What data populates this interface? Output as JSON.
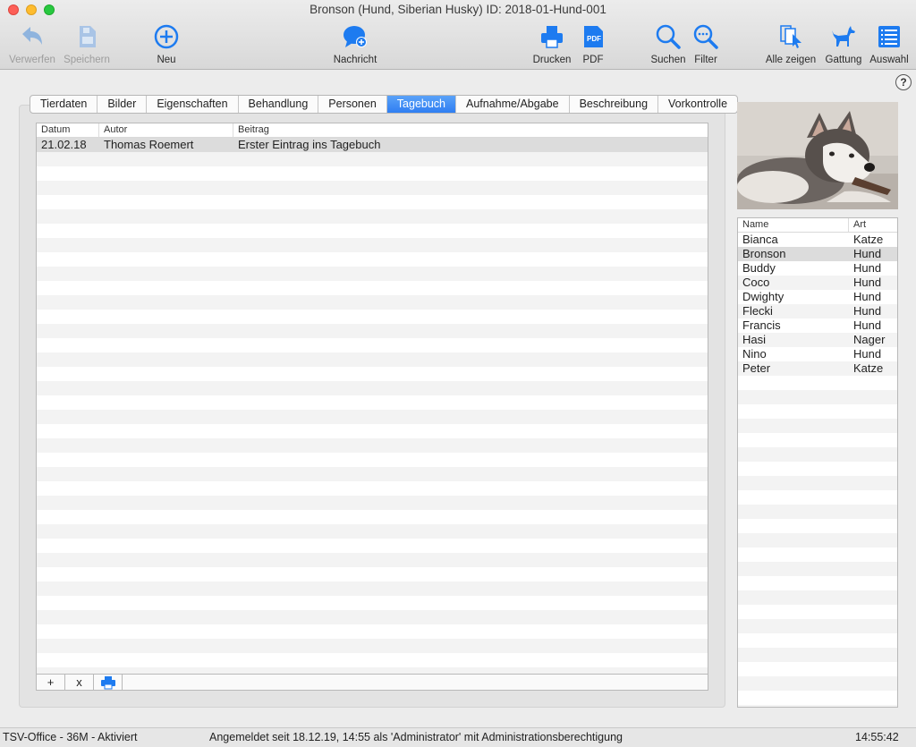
{
  "window": {
    "title": "Bronson (Hund, Siberian Husky) ID: 2018-01-Hund-001"
  },
  "toolbar": {
    "verwerfen": "Verwerfen",
    "speichern": "Speichern",
    "neu": "Neu",
    "nachricht": "Nachricht",
    "drucken": "Drucken",
    "pdf": "PDF",
    "suchen": "Suchen",
    "filter": "Filter",
    "alle_zeigen": "Alle zeigen",
    "gattung": "Gattung",
    "auswahl": "Auswahl"
  },
  "help": "?",
  "tabs": [
    {
      "label": "Tierdaten"
    },
    {
      "label": "Bilder"
    },
    {
      "label": "Eigenschaften"
    },
    {
      "label": "Behandlung"
    },
    {
      "label": "Personen"
    },
    {
      "label": "Tagebuch",
      "active": true
    },
    {
      "label": "Aufnahme/Abgabe"
    },
    {
      "label": "Beschreibung"
    },
    {
      "label": "Vorkontrolle"
    }
  ],
  "diary": {
    "columns": [
      "Datum",
      "Autor",
      "Beitrag"
    ],
    "rows": [
      {
        "datum": "21.02.18",
        "autor": "Thomas Roemert",
        "beitrag": "Erster Eintrag ins Tagebuch"
      }
    ],
    "footer": {
      "add": "+",
      "remove": "x"
    }
  },
  "animals": {
    "columns": [
      "Name",
      "Art"
    ],
    "rows": [
      {
        "name": "Bianca",
        "art": "Katze"
      },
      {
        "name": "Bronson",
        "art": "Hund",
        "selected": true
      },
      {
        "name": "Buddy",
        "art": "Hund"
      },
      {
        "name": "Coco",
        "art": "Hund"
      },
      {
        "name": "Dwighty",
        "art": "Hund"
      },
      {
        "name": "Flecki",
        "art": "Hund"
      },
      {
        "name": "Francis",
        "art": "Hund"
      },
      {
        "name": "Hasi",
        "art": "Nager"
      },
      {
        "name": "Nino",
        "art": "Hund"
      },
      {
        "name": "Peter",
        "art": "Katze"
      }
    ]
  },
  "status": {
    "left": "TSV-Office - 36M - Aktiviert",
    "center": "Angemeldet seit 18.12.19, 14:55 als 'Administrator' mit Administrationsberechtigung",
    "time": "14:55:42"
  },
  "colors": {
    "accent": "#2f7ef2",
    "icon_blue": "#1d7bf0",
    "disabled": "#9d9d9d"
  }
}
